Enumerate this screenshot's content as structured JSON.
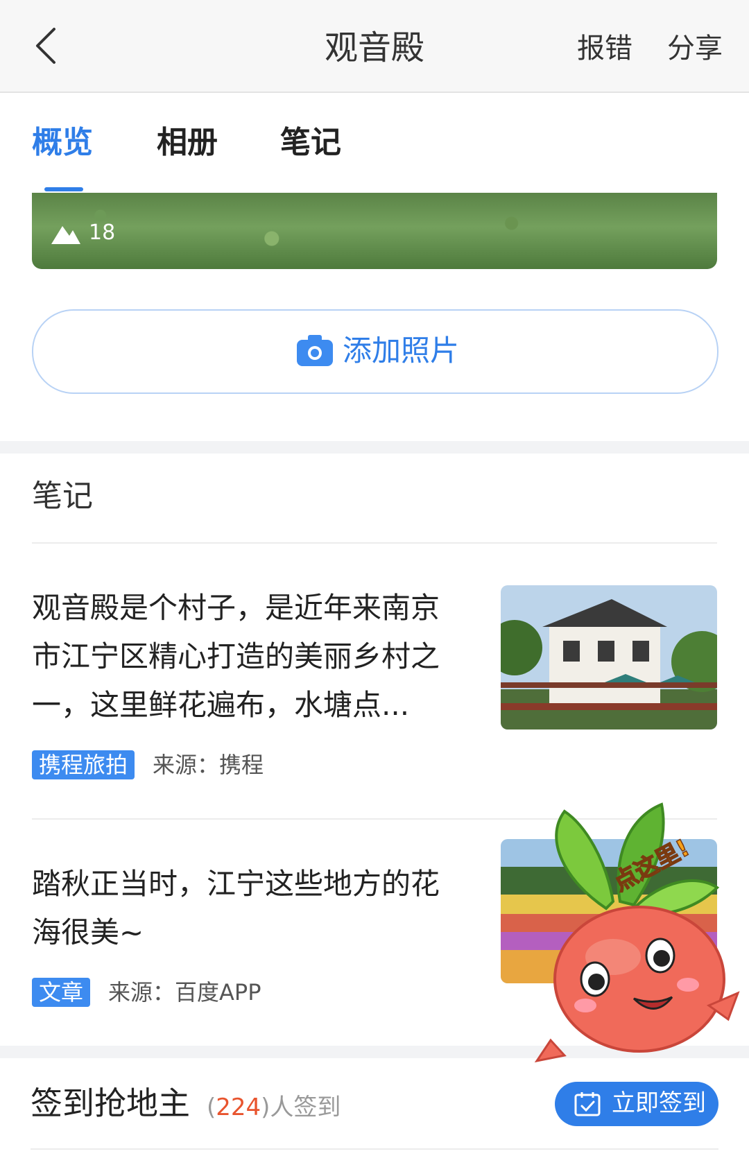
{
  "header": {
    "title": "观音殿",
    "report_label": "报错",
    "share_label": "分享"
  },
  "tabs": [
    {
      "label": "概览",
      "active": true
    },
    {
      "label": "相册",
      "active": false
    },
    {
      "label": "笔记",
      "active": false
    }
  ],
  "album": {
    "photo_count": "18",
    "add_photo_label": "添加照片"
  },
  "notes": {
    "section_title": "笔记",
    "items": [
      {
        "text": "观音殿是个村子，是近年来南京市江宁区精心打造的美丽乡村之一，这里鲜花遍布，水塘点...",
        "tag": "携程旅拍",
        "source": "来源：携程"
      },
      {
        "text": "踏秋正当时，江宁这些地方的花海很美~",
        "tag": "文章",
        "source": "来源：百度APP"
      }
    ]
  },
  "checkin": {
    "title": "签到抢地主",
    "count_open": "(",
    "count": "224",
    "count_suffix": ")人签到",
    "button_label": "立即签到"
  },
  "mascot": {
    "bubble_text": "点这里!"
  },
  "colors": {
    "accent": "#2f7ee8",
    "tag_bg": "#3d8bf0",
    "count_red": "#e8542e"
  }
}
